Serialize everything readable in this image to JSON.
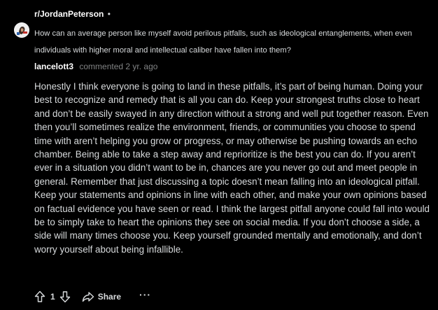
{
  "post": {
    "subreddit": "r/JordanPeterson",
    "separator": "•",
    "title": "How can an average person like myself avoid perilous pitfalls, such as ideological entanglements, when even individuals with higher moral and intellectual caliber have fallen into them?"
  },
  "comment": {
    "author": "lancelott3",
    "action": "commented",
    "time": "2 yr. ago",
    "body": "Honestly I think everyone is going to land in these pitfalls, it’s part of being human. Doing your best to recognize and remedy that is all you can do. Keep your strongest truths close to heart and don’t be easily swayed in any direction without a strong and well put together reason. Even then you’ll sometimes realize the environment, friends, or communities you choose to spend time with aren’t helping you grow or progress, or may otherwise be pushing towards an echo chamber. Being able to take a step away and reprioritize is the best you can do. If you aren’t ever in a situation you didn’t want to be in, chances are you never go out and meet people in general. Remember that just discussing a topic doesn’t mean falling into an ideological pitfall. Keep your statements and opinions in line with each other, and make your own opinions based on factual evidence you have seen or read. I think the largest pitfall anyone could fall into would be to simply take to heart the opinions they see on social media. If you don’t choose a side, a side will many times choose you. Keep yourself grounded mentally and emotionally, and don’t worry yourself about being infallible."
  },
  "actions": {
    "upvote_icon": "upvote-arrow-icon",
    "vote_count": "1",
    "downvote_icon": "downvote-arrow-icon",
    "share_icon": "share-arrow-icon",
    "share_label": "Share",
    "more_label": "···"
  },
  "colors": {
    "background": "#000000",
    "text_primary": "#d7dadc",
    "text_muted": "#818384",
    "text_strong": "#ffffff"
  }
}
